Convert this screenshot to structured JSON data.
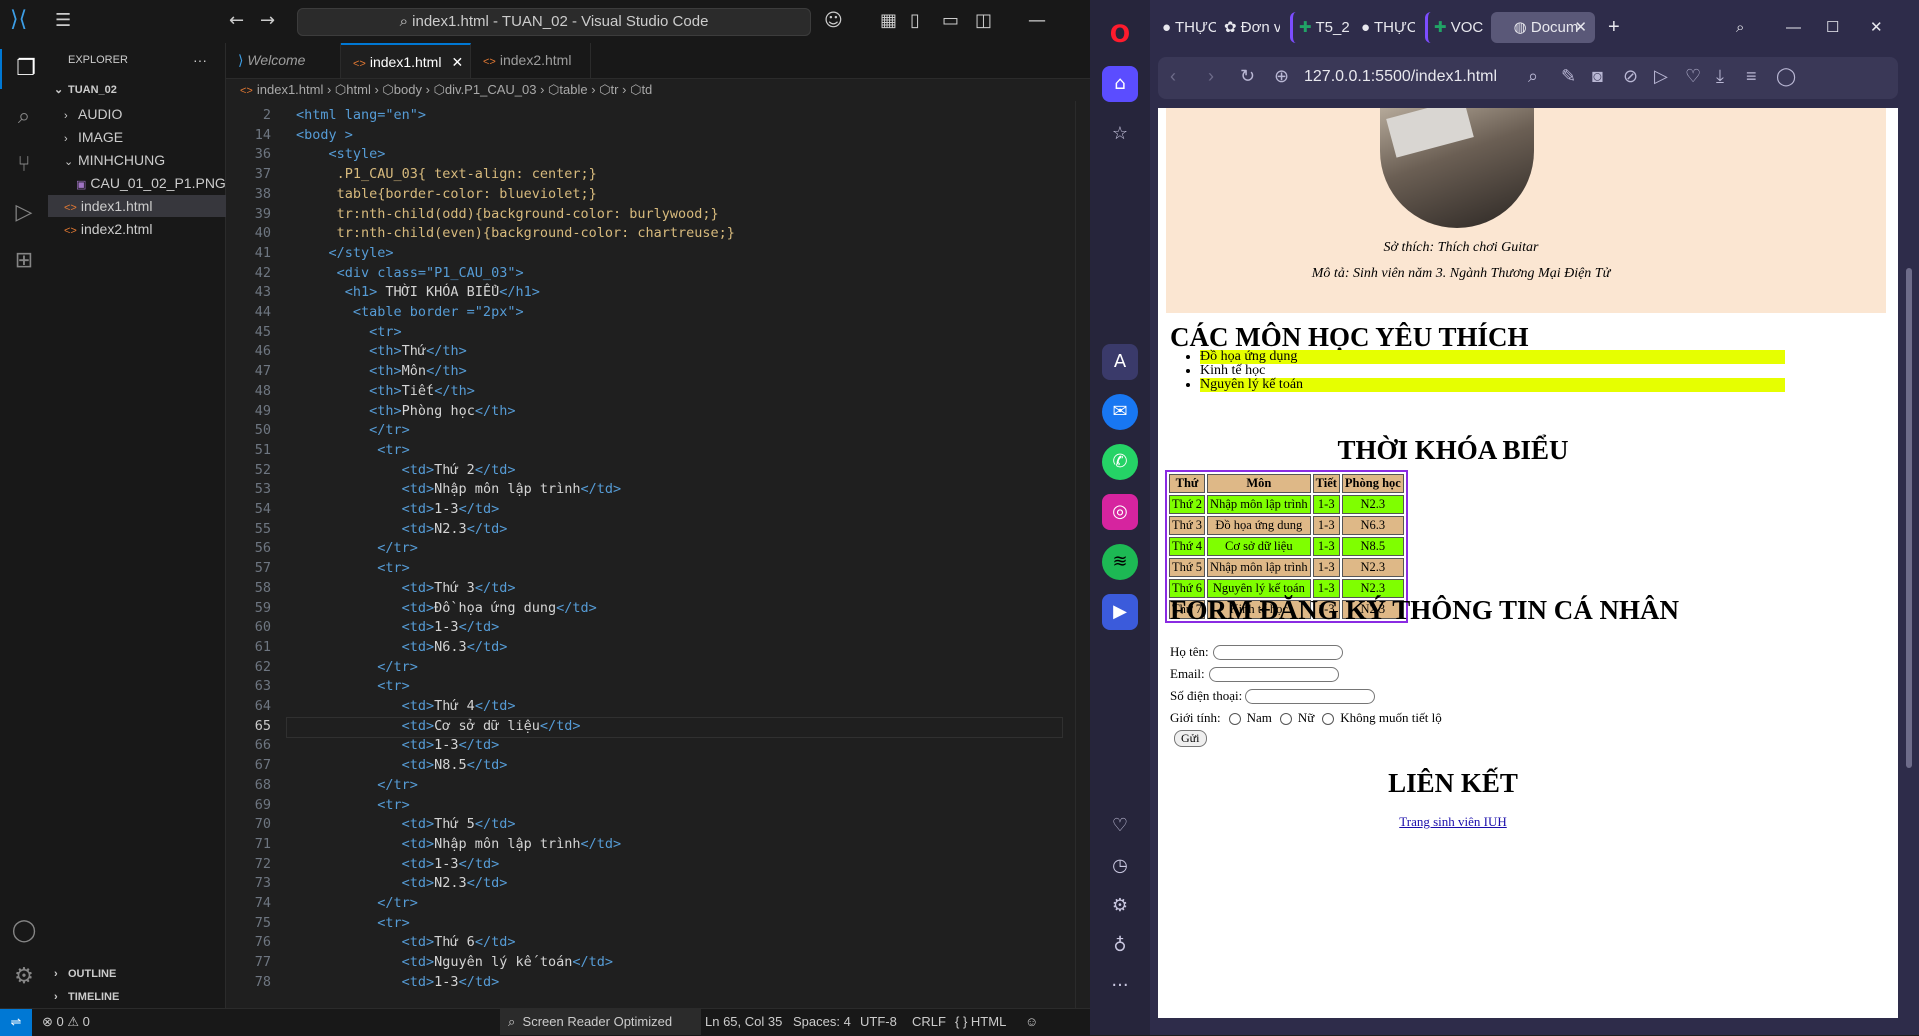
{
  "vscode": {
    "title": "index1.html - TUAN_02 - Visual Studio Code",
    "explorer": {
      "header": "EXPLORER",
      "root": "TUAN_02",
      "items": [
        {
          "label": "AUDIO",
          "type": "folder",
          "open": false
        },
        {
          "label": "IMAGE",
          "type": "folder",
          "open": false
        },
        {
          "label": "MINHCHUNG",
          "type": "folder",
          "open": true
        },
        {
          "label": "CAU_01_02_P1.PNG",
          "type": "png"
        },
        {
          "label": "index1.html",
          "type": "html",
          "selected": true
        },
        {
          "label": "index2.html",
          "type": "html"
        }
      ],
      "outline": "OUTLINE",
      "timeline": "TIMELINE"
    },
    "tabs": [
      {
        "label": "Welcome",
        "active": false
      },
      {
        "label": "index1.html",
        "active": true
      },
      {
        "label": "index2.html",
        "active": false
      }
    ],
    "breadcrumb": [
      "index1.html",
      "html",
      "body",
      "div.P1_CAU_03",
      "table",
      "tr",
      "td"
    ],
    "current_line": 65,
    "code": [
      {
        "n": 2,
        "t": "<html lang=\"en\">"
      },
      {
        "n": 14,
        "t": "<body >"
      },
      {
        "n": 36,
        "t": "    <style>"
      },
      {
        "n": 37,
        "t": "     .P1_CAU_03{ text-align: center;}"
      },
      {
        "n": 38,
        "t": "     table{border-color: blueviolet;}"
      },
      {
        "n": 39,
        "t": "     tr:nth-child(odd){background-color: burlywood;}"
      },
      {
        "n": 40,
        "t": "     tr:nth-child(even){background-color: chartreuse;}"
      },
      {
        "n": 41,
        "t": "    </style>"
      },
      {
        "n": 42,
        "t": "     <div class=\"P1_CAU_03\">"
      },
      {
        "n": 43,
        "t": "      <h1> THỜI KHÓA BIỂU</h1>"
      },
      {
        "n": 44,
        "t": "       <table border =\"2px\">"
      },
      {
        "n": 45,
        "t": "         <tr>"
      },
      {
        "n": 46,
        "t": "         <th>Thứ</th>"
      },
      {
        "n": 47,
        "t": "         <th>Môn</th>"
      },
      {
        "n": 48,
        "t": "         <th>Tiết</th>"
      },
      {
        "n": 49,
        "t": "         <th>Phòng học</th>"
      },
      {
        "n": 50,
        "t": "         </tr>"
      },
      {
        "n": 51,
        "t": "          <tr>"
      },
      {
        "n": 52,
        "t": "             <td>Thứ 2</td>"
      },
      {
        "n": 53,
        "t": "             <td>Nhập môn lập trình</td>"
      },
      {
        "n": 54,
        "t": "             <td>1-3</td>"
      },
      {
        "n": 55,
        "t": "             <td>N2.3</td>"
      },
      {
        "n": 56,
        "t": "          </tr>"
      },
      {
        "n": 57,
        "t": "          <tr>"
      },
      {
        "n": 58,
        "t": "             <td>Thứ 3</td>"
      },
      {
        "n": 59,
        "t": "             <td>Đồ họa ứng dung</td>"
      },
      {
        "n": 60,
        "t": "             <td>1-3</td>"
      },
      {
        "n": 61,
        "t": "             <td>N6.3</td>"
      },
      {
        "n": 62,
        "t": "          </tr>"
      },
      {
        "n": 63,
        "t": "          <tr>"
      },
      {
        "n": 64,
        "t": "             <td>Thứ 4</td>"
      },
      {
        "n": 65,
        "t": "             <td>Cơ sở dữ liệu</td>"
      },
      {
        "n": 66,
        "t": "             <td>1-3</td>"
      },
      {
        "n": 67,
        "t": "             <td>N8.5</td>"
      },
      {
        "n": 68,
        "t": "          </tr>"
      },
      {
        "n": 69,
        "t": "          <tr>"
      },
      {
        "n": 70,
        "t": "             <td>Thứ 5</td>"
      },
      {
        "n": 71,
        "t": "             <td>Nhập môn lập trình</td>"
      },
      {
        "n": 72,
        "t": "             <td>1-3</td>"
      },
      {
        "n": 73,
        "t": "             <td>N2.3</td>"
      },
      {
        "n": 74,
        "t": "          </tr>"
      },
      {
        "n": 75,
        "t": "          <tr>"
      },
      {
        "n": 76,
        "t": "             <td>Thứ 6</td>"
      },
      {
        "n": 77,
        "t": "             <td>Nguyên lý kế toán</td>"
      },
      {
        "n": 78,
        "t": "             <td>1-3</td>"
      }
    ],
    "status": {
      "errors": "0",
      "warnings": "0",
      "screen_reader": "Screen Reader Optimized",
      "position": "Ln 65, Col 35",
      "spaces": "Spaces: 4",
      "encoding": "UTF-8",
      "eol": "CRLF",
      "language": "HTML"
    }
  },
  "browser": {
    "tabs": [
      {
        "label": "THỰC",
        "icon": "github-icon"
      },
      {
        "label": "Đơn v",
        "icon": "chatgpt-icon"
      },
      {
        "label": "T5_2",
        "icon": "sheets-icon"
      },
      {
        "label": "THỰC",
        "icon": "github-icon"
      },
      {
        "label": "VOC",
        "icon": "sheets-icon"
      },
      {
        "label": "Docum",
        "icon": "globe-icon",
        "active": true
      }
    ],
    "url": "127.0.0.1:5500/index1.html",
    "page": {
      "hobby": "Sở thích: Thích chơi Guitar",
      "description": "Mô tả: Sinh viên năm 3. Ngành Thương Mại Điện Tử",
      "fav_heading": "CÁC MÔN HỌC YÊU THÍCH",
      "fav_items": [
        "Đồ họa ứng dụng",
        "Kinh tế học",
        "Nguyên lý kế toán"
      ],
      "tkb_heading": "THỜI KHÓA BIỂU",
      "tkb_headers": [
        "Thứ",
        "Môn",
        "Tiết",
        "Phòng học"
      ],
      "tkb_rows": [
        [
          "Thứ 2",
          "Nhập môn lập trình",
          "1-3",
          "N2.3"
        ],
        [
          "Thứ 3",
          "Đồ họa ứng dung",
          "1-3",
          "N6.3"
        ],
        [
          "Thứ 4",
          "Cơ sở dữ liệu",
          "1-3",
          "N8.5"
        ],
        [
          "Thứ 5",
          "Nhập môn lập trình",
          "1-3",
          "N2.3"
        ],
        [
          "Thứ 6",
          "Nguyên lý kế toán",
          "1-3",
          "N2.3"
        ],
        [
          "Thứ 7",
          "Kinh tế học",
          "1-3",
          "N2.3"
        ]
      ],
      "form_heading": "FORM ĐĂNG KÝ THÔNG TIN CÁ NHÂN",
      "form": {
        "name_label": "Họ tên:",
        "email_label": "Email:",
        "phone_label": "Số điện thoại:",
        "gender_label": "Giới tính:",
        "gender_options": [
          "Nam",
          "Nữ",
          "Không muốn tiết lộ"
        ],
        "submit": "Gửi"
      },
      "links_heading": "LIÊN KẾT",
      "link_text": "Trang sinh viên IUH"
    }
  }
}
